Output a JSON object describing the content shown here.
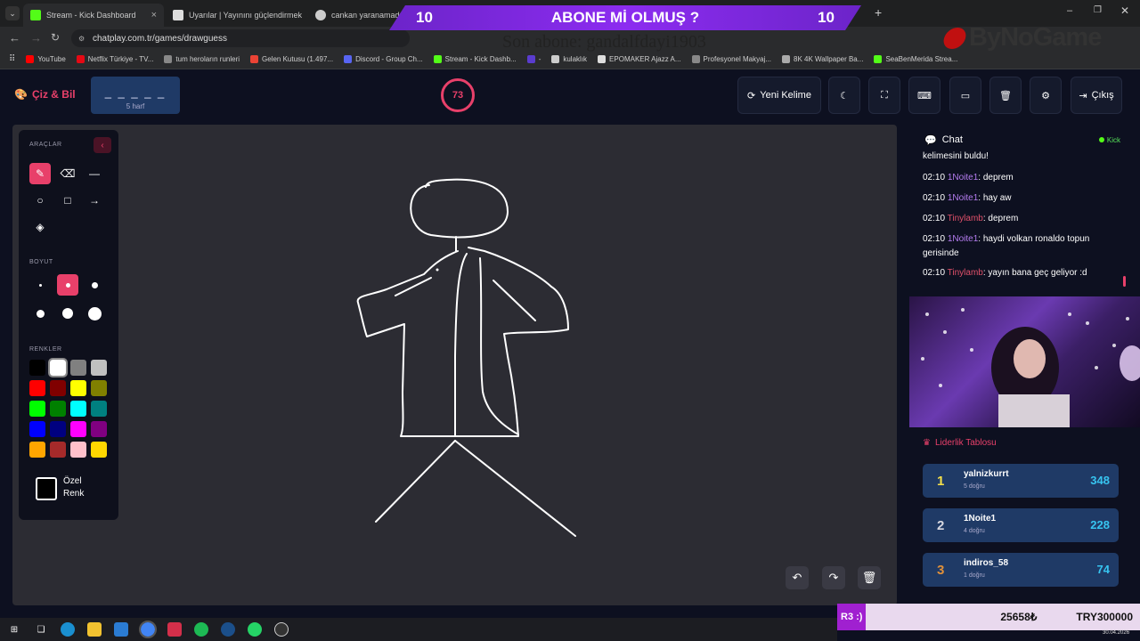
{
  "browser": {
    "tabs": [
      {
        "title": "Stream - Kick Dashboard",
        "color": "#53fc18"
      },
      {
        "title": "Uyarılar | Yayınını güçlendirmek",
        "color": "#ffffff"
      },
      {
        "title": "cankan yaranamadım sözl",
        "color": "#cccccc"
      }
    ],
    "url": "chatplay.com.tr/games/drawguess",
    "bookmarks": [
      {
        "label": "YouTube",
        "color": "#ff0000"
      },
      {
        "label": "Netflix Türkiye - TV...",
        "color": "#e50914"
      },
      {
        "label": "tum heroların runleri",
        "color": "#888888"
      },
      {
        "label": "Gelen Kutusu (1.497...",
        "color": "#ea4335"
      },
      {
        "label": "Discord - Group Ch...",
        "color": "#5865f2"
      },
      {
        "label": "Stream - Kick Dashb...",
        "color": "#53fc18"
      },
      {
        "label": "-",
        "color": "#5a3ccf"
      },
      {
        "label": "kulaklık",
        "color": "#cccccc"
      },
      {
        "label": "EPOMAKER Ajazz A...",
        "color": "#dddddd"
      },
      {
        "label": "Profesyonel Makyaj...",
        "color": "#888888"
      },
      {
        "label": "8K 4K Wallpaper Ba...",
        "color": "#aaaaaa"
      },
      {
        "label": "SeaBenMerida Strea...",
        "color": "#53fc18"
      }
    ]
  },
  "overlay": {
    "left_num": "10",
    "title": "ABONE Mİ OLMUŞ ?",
    "right_num": "10",
    "last_sub": "Son abone: gandalfdayi1903",
    "logo": "ByNoGame"
  },
  "app": {
    "logo": "Çiz & Bil",
    "word_mask": "_ _ _ _ _",
    "word_len": "5 harf",
    "timer": "73",
    "new_word": "Yeni Kelime",
    "exit": "Çıkış"
  },
  "tools": {
    "tools_title": "ARAÇLAR",
    "size_title": "BOYUT",
    "colors_title": "RENKLER",
    "custom_color_1": "Özel",
    "custom_color_2": "Renk",
    "palette": [
      "#000000",
      "#ffffff",
      "#808080",
      "#c0c0c0",
      "#ff0000",
      "#800000",
      "#ffff00",
      "#808000",
      "#00ff00",
      "#008000",
      "#00ffff",
      "#008080",
      "#0000ff",
      "#000080",
      "#ff00ff",
      "#800080",
      "#ffa500",
      "#a52a2a",
      "#ffc0cb",
      "#ffd700"
    ]
  },
  "chat": {
    "title": "Chat",
    "platform": "Kick",
    "partial": "kelimesini buldu!",
    "messages": [
      {
        "time": "02:10",
        "user": "1Noite1",
        "text": ": deprem",
        "style": "u"
      },
      {
        "time": "02:10",
        "user": "1Noite1",
        "text": ": hay aw",
        "style": "u"
      },
      {
        "time": "02:10",
        "user": "Tinylamb",
        "text": ": deprem",
        "style": "u2"
      },
      {
        "time": "02:10",
        "user": "1Noite1",
        "text": ": haydi volkan ronaldo topun gerisinde",
        "style": "u"
      },
      {
        "time": "02:10",
        "user": "Tinylamb",
        "text": ": yayın bana geç geliyor :d",
        "style": "u2"
      }
    ]
  },
  "leaderboard": {
    "title": "Liderlik Tablosu",
    "rows": [
      {
        "rank": "1",
        "name": "yalnizkurrt",
        "sub": "5 doğru",
        "pts": "348",
        "color": "#f5e04a"
      },
      {
        "rank": "2",
        "name": "1Noite1",
        "sub": "4 doğru",
        "pts": "228",
        "color": "#d8d8e0"
      },
      {
        "rank": "3",
        "name": "indiros_58",
        "sub": "1 doğru",
        "pts": "74",
        "color": "#e0903a"
      }
    ]
  },
  "donation": {
    "tag": "R3 :)",
    "amount": "25658₺",
    "goal": "TRY300000"
  },
  "clock": "30.04.2026"
}
